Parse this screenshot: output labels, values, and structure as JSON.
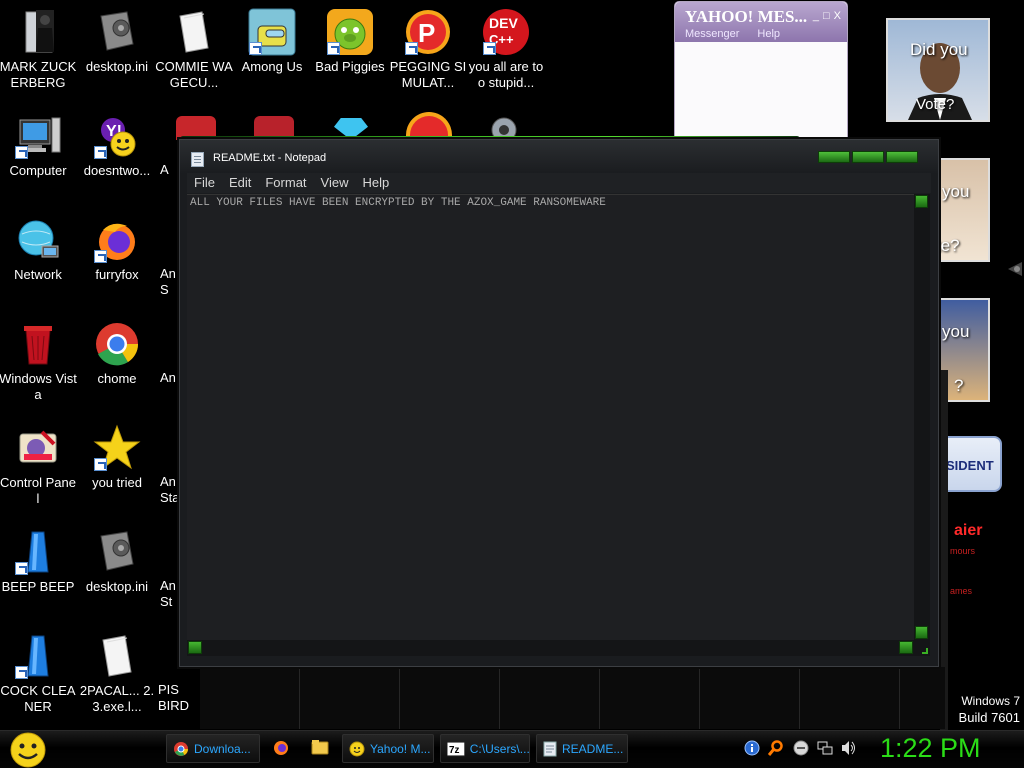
{
  "desktop_icons": [
    {
      "id": "mark",
      "label": "MARK ZUCKERBERG",
      "icon": "black-suit-figure-icon"
    },
    {
      "id": "desktopini1",
      "label": "desktop.ini",
      "icon": "settings-file-icon"
    },
    {
      "id": "commie",
      "label": "COMMIE WAGECU...",
      "icon": "document-file-icon"
    },
    {
      "id": "amongus",
      "label": "Among Us",
      "icon": "among-us-icon"
    },
    {
      "id": "badpiggies",
      "label": "Bad Piggies",
      "icon": "green-pig-icon"
    },
    {
      "id": "pegging",
      "label": "PEGGING SIMULAT...",
      "icon": "red-p-logo-icon"
    },
    {
      "id": "devcpp",
      "label": "you all are too stupid...",
      "icon": "dev-cpp-icon"
    },
    {
      "id": "computer",
      "label": "Computer",
      "icon": "computer-icon"
    },
    {
      "id": "doesntwork",
      "label": "doesntwo...",
      "icon": "yahoo-messenger-icon"
    },
    {
      "id": "network",
      "label": "Network",
      "icon": "network-globe-icon"
    },
    {
      "id": "furryfox",
      "label": "furryfox",
      "icon": "firefox-icon"
    },
    {
      "id": "windowsvista",
      "label": "Windows Vista",
      "icon": "recycle-bin-icon"
    },
    {
      "id": "chome",
      "label": "chome",
      "icon": "chrome-icon"
    },
    {
      "id": "controlpanel",
      "label": "Control Panel",
      "icon": "control-panel-icon"
    },
    {
      "id": "youtried",
      "label": "you tried",
      "icon": "gold-star-icon"
    },
    {
      "id": "beepbeep",
      "label": "BEEP BEEP",
      "icon": "blue-bottle-icon"
    },
    {
      "id": "desktopini2",
      "label": "desktop.ini",
      "icon": "settings-file-icon"
    },
    {
      "id": "cockcleaner",
      "label": "COCK CLEANER",
      "icon": "blue-bottle-icon"
    },
    {
      "id": "pacal",
      "label": "2PACAL... 2.3.exe.l...",
      "icon": "document-file-icon"
    }
  ],
  "partial_labels": {
    "col3_row2": "A",
    "col3_row3": "An S",
    "col3_row4": "An",
    "col3_row5": "An Sta",
    "col3_row6": "An St",
    "col3_row7": "PIS BIRD"
  },
  "yahoo_messenger": {
    "title": "YAHOO! MES...",
    "menu": [
      "Messenger",
      "Help"
    ],
    "buttons": [
      "_",
      "□",
      "X"
    ]
  },
  "gadgets": {
    "photo1_text": [
      "Did you",
      "Vote?"
    ],
    "photo2_text": [
      "you",
      "te?"
    ],
    "photo3_text": [
      "you",
      "?"
    ],
    "badge": "SIDENT",
    "red_text": "aier",
    "red_small": "mours",
    "red_small2": "ames"
  },
  "notepad": {
    "title": "README.txt - Notepad",
    "menu": [
      "File",
      "Edit",
      "Format",
      "View",
      "Help"
    ],
    "content": "ALL YOUR FILES HAVE BEEN ENCRYPTED BY THE AZOX_GAME RANSOMEWARE"
  },
  "taskbar": {
    "buttons": [
      {
        "label": "Downloa...",
        "icon": "chrome-icon"
      },
      {
        "label": "Yahoo! M...",
        "icon": "yahoo-messenger-icon"
      },
      {
        "label": "C:\\Users\\...",
        "icon": "7zip-icon"
      },
      {
        "label": "README...",
        "icon": "notepad-icon"
      }
    ],
    "clock": "1:22 PM"
  },
  "watermark": {
    "line1": "Windows 7",
    "line2": "Build 7601"
  },
  "colors": {
    "accent_green": "#2bdc17",
    "taskbar_text": "#2ba7ff"
  }
}
